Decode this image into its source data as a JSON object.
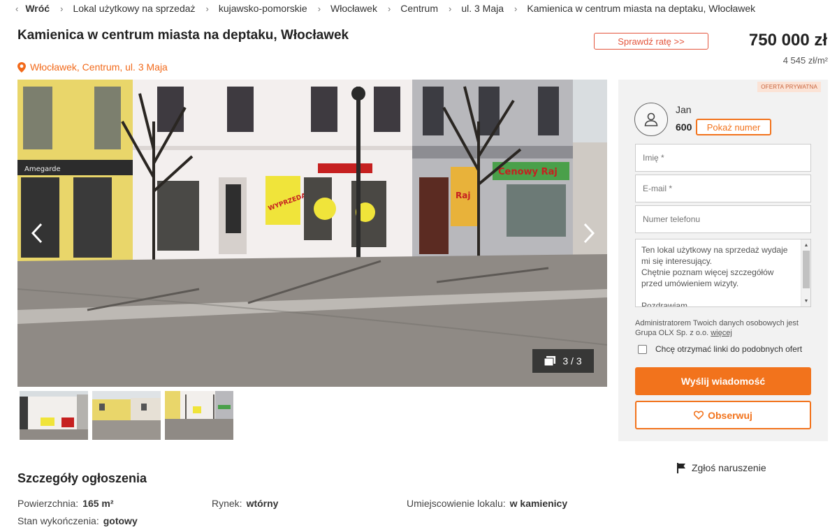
{
  "breadcrumb": {
    "back": "Wróć",
    "items": [
      "Lokal użytkowy na sprzedaż",
      "kujawsko-pomorskie",
      "Włocławek",
      "Centrum",
      "ul. 3 Maja",
      "Kamienica w centrum miasta na deptaku, Włocławek"
    ]
  },
  "listing": {
    "title": "Kamienica w centrum miasta na deptaku, Włocławek",
    "location": "Włocławek, Centrum, ul. 3 Maja",
    "rate_button": "Sprawdź ratę >>",
    "price": "750 000 zł",
    "price_per_m2": "4 545 zł/m²"
  },
  "gallery": {
    "counter": "3 / 3",
    "sign_texts": [
      "WYPRZEDAŻ",
      "Cenowy Raj",
      "Raj",
      "Amegarde"
    ],
    "thumbnails": 3
  },
  "sidebar": {
    "badge": "OFERTA PRYWATNA",
    "seller_name": "Jan",
    "phone_prefix": "600",
    "show_number": "Pokaż numer",
    "name_placeholder": "Imię *",
    "email_placeholder": "E-mail *",
    "phone_placeholder": "Numer telefonu",
    "message": "Ten lokal użytkowy na sprzedaż wydaje mi się interesujący.\nChętnie poznam więcej szczegółów przed umówieniem wizyty.\n\nPozdrawiam",
    "admin_text": "Administratorem Twoich danych osobowych jest Grupa OLX Sp. z o.o.",
    "admin_link": "więcej",
    "similar_offers": "Chcę otrzymać linki do podobnych ofert",
    "send_button": "Wyślij wiadomość",
    "watch_button": "Obserwuj"
  },
  "report": "Zgłoś naruszenie",
  "details": {
    "heading": "Szczegóły ogłoszenia",
    "items": [
      {
        "label": "Powierzchnia:",
        "value": "165 m²"
      },
      {
        "label": "Rynek:",
        "value": "wtórny"
      },
      {
        "label": "Umiejscowienie lokalu:",
        "value": "w kamienicy"
      },
      {
        "label": "Stan wykończenia:",
        "value": "gotowy"
      }
    ]
  },
  "colors": {
    "accent": "#f2731c",
    "rate_border": "#e3553c"
  }
}
